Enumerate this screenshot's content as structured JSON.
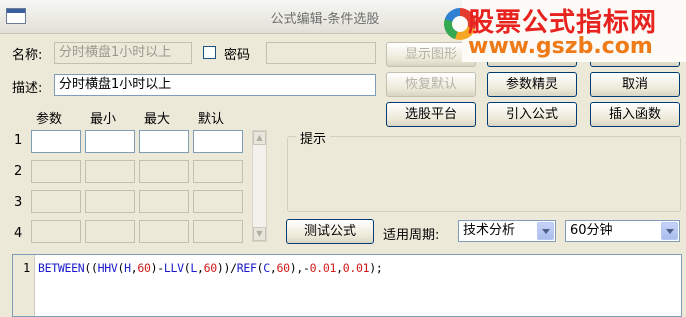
{
  "window": {
    "title": "公式编辑-条件选股",
    "icon": "window-icon"
  },
  "watermark": {
    "title": "股票公式指标网",
    "url": "www.gszb.com",
    "colors": {
      "title": "#e8231f",
      "url": "#ee7a18"
    }
  },
  "form": {
    "name_label": "名称:",
    "name_value": "分时横盘1小时以上",
    "password_label": "密码",
    "password_checked": false,
    "password_value": "",
    "desc_label": "描述:",
    "desc_value": "分时横盘1小时以上"
  },
  "buttons": {
    "show_chart": "显示图形",
    "top_mid": "",
    "top_right": "",
    "restore_default": "恢复默认",
    "param_wizard": "参数精灵",
    "cancel": "取消",
    "stock_platform": "选股平台",
    "import_formula": "引入公式",
    "insert_function": "插入函数",
    "test_formula": "测试公式"
  },
  "params": {
    "headers": [
      "参数",
      "最小",
      "最大",
      "默认"
    ],
    "row_numbers": [
      "1",
      "2",
      "3",
      "4"
    ]
  },
  "hint": {
    "title": "提示"
  },
  "period": {
    "label": "适用周期:",
    "analysis_type": "技术分析",
    "timeframe": "60分钟"
  },
  "editor": {
    "line_number": "1",
    "code_tokens": [
      {
        "t": "BETWEEN",
        "c": "kw"
      },
      {
        "t": "((",
        "c": "pn"
      },
      {
        "t": "HHV",
        "c": "kw"
      },
      {
        "t": "(",
        "c": "pn"
      },
      {
        "t": "H",
        "c": "kw"
      },
      {
        "t": ",",
        "c": "pn"
      },
      {
        "t": "60",
        "c": "num"
      },
      {
        "t": ")-",
        "c": "pn"
      },
      {
        "t": "LLV",
        "c": "kw"
      },
      {
        "t": "(",
        "c": "pn"
      },
      {
        "t": "L",
        "c": "kw"
      },
      {
        "t": ",",
        "c": "pn"
      },
      {
        "t": "60",
        "c": "num"
      },
      {
        "t": "))/",
        "c": "pn"
      },
      {
        "t": "REF",
        "c": "kw"
      },
      {
        "t": "(",
        "c": "pn"
      },
      {
        "t": "C",
        "c": "kw"
      },
      {
        "t": ",",
        "c": "pn"
      },
      {
        "t": "60",
        "c": "num"
      },
      {
        "t": "),-",
        "c": "pn"
      },
      {
        "t": "0.01",
        "c": "num"
      },
      {
        "t": ",",
        "c": "pn"
      },
      {
        "t": "0.01",
        "c": "num"
      },
      {
        "t": ");",
        "c": "pn"
      }
    ]
  }
}
